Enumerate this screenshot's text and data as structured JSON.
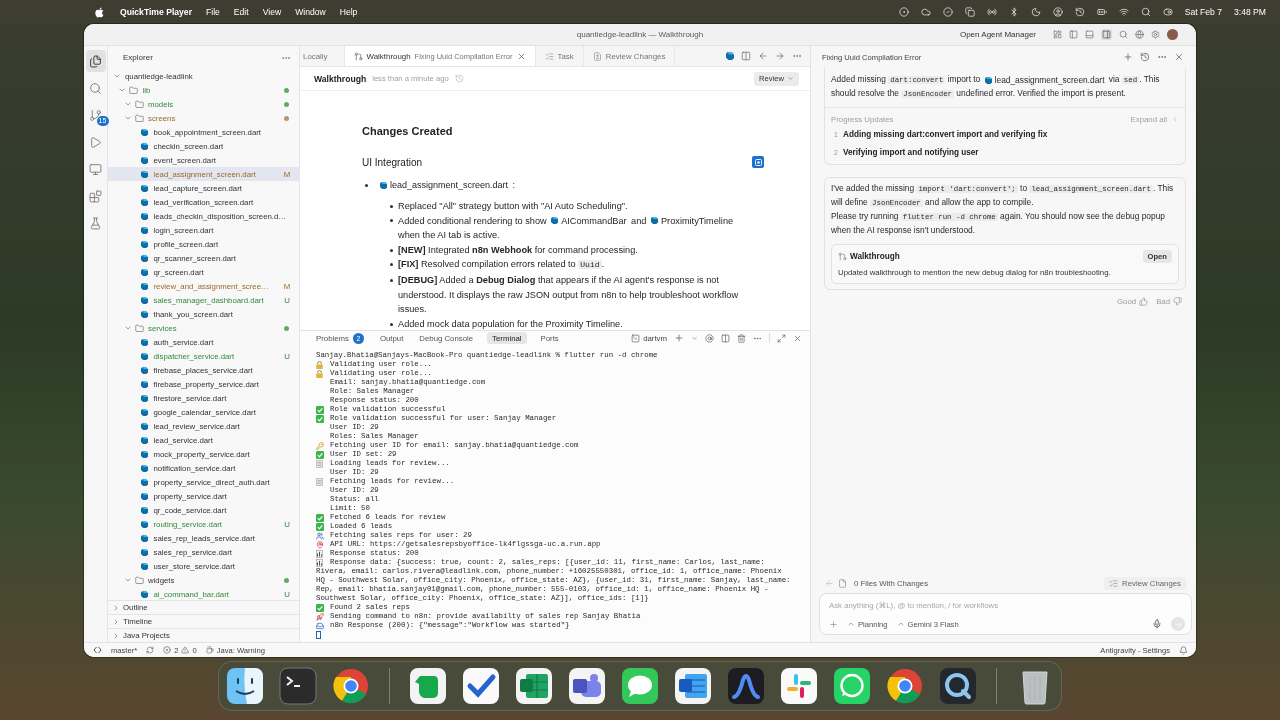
{
  "menu_bar": {
    "app": "QuickTime Player",
    "menus": [
      "File",
      "Edit",
      "View",
      "Window",
      "Help"
    ],
    "date": "Sat Feb 7",
    "time": "3:48 PM"
  },
  "window": {
    "title": "quantiedge-leadlink — Walkthrough",
    "agent_manager": "Open Agent Manager"
  },
  "activity_bar": {
    "items": [
      {
        "kind": "files",
        "selected": true
      },
      {
        "kind": "search",
        "selected": false
      },
      {
        "kind": "source-control",
        "selected": false,
        "badge": "15"
      },
      {
        "kind": "run",
        "selected": false
      },
      {
        "kind": "remote",
        "selected": false
      },
      {
        "kind": "extensions",
        "selected": false
      },
      {
        "kind": "testing",
        "selected": false
      }
    ]
  },
  "explorer": {
    "title": "Explorer",
    "tree": [
      {
        "name": "quantiedge-leadlink",
        "kind": "root",
        "expanded": true,
        "selected": false,
        "modified": false,
        "untracked": false,
        "children": [
          {
            "name": "lib",
            "kind": "folder",
            "expanded": true,
            "selected": false,
            "modified": false,
            "untracked": true,
            "color": "#5fab64",
            "children": [
              {
                "name": "models",
                "kind": "folder",
                "expanded": true,
                "selected": false,
                "modified": false,
                "untracked": true,
                "color": "#5fab64"
              },
              {
                "name": "screens",
                "kind": "folder",
                "expanded": true,
                "selected": false,
                "modified": true,
                "untracked": false,
                "color": "#b59672",
                "children": [
                  {
                    "name": "book_appointment_screen.dart",
                    "kind": "file",
                    "selected": false,
                    "modified": false,
                    "untracked": false
                  },
                  {
                    "name": "checkin_screen.dart",
                    "kind": "file",
                    "selected": false,
                    "modified": false,
                    "untracked": false
                  },
                  {
                    "name": "event_screen.dart",
                    "kind": "file",
                    "selected": false,
                    "modified": false,
                    "untracked": false
                  },
                  {
                    "name": "lead_assignment_screen.dart",
                    "kind": "file",
                    "selected": true,
                    "modified": true,
                    "untracked": false,
                    "badge": "M"
                  },
                  {
                    "name": "lead_capture_screen.dart",
                    "kind": "file",
                    "selected": false,
                    "modified": false,
                    "untracked": false
                  },
                  {
                    "name": "lead_verification_screen.dart",
                    "kind": "file",
                    "selected": false,
                    "modified": false,
                    "untracked": false
                  },
                  {
                    "name": "leads_checkin_disposition_screen.d…",
                    "kind": "file",
                    "selected": false,
                    "modified": false,
                    "untracked": false
                  },
                  {
                    "name": "login_screen.dart",
                    "kind": "file",
                    "selected": false,
                    "modified": false,
                    "untracked": false
                  },
                  {
                    "name": "profile_screen.dart",
                    "kind": "file",
                    "selected": false,
                    "modified": false,
                    "untracked": false
                  },
                  {
                    "name": "qr_scanner_screen.dart",
                    "kind": "file",
                    "selected": false,
                    "modified": false,
                    "untracked": false
                  },
                  {
                    "name": "qr_screen.dart",
                    "kind": "file",
                    "selected": false,
                    "modified": false,
                    "untracked": false
                  },
                  {
                    "name": "review_and_assignment_scree…",
                    "kind": "file",
                    "selected": false,
                    "modified": true,
                    "untracked": false,
                    "badge": "M"
                  },
                  {
                    "name": "sales_manager_dashboard.dart",
                    "kind": "file",
                    "selected": false,
                    "modified": false,
                    "untracked": true,
                    "badge": "U"
                  },
                  {
                    "name": "thank_you_screen.dart",
                    "kind": "file",
                    "selected": false,
                    "modified": false,
                    "untracked": false
                  }
                ]
              },
              {
                "name": "services",
                "kind": "folder",
                "expanded": true,
                "selected": false,
                "modified": false,
                "untracked": true,
                "color": "#5fab64",
                "children": [
                  {
                    "name": "auth_service.dart",
                    "kind": "file",
                    "selected": false,
                    "modified": false,
                    "untracked": false
                  },
                  {
                    "name": "dispatcher_service.dart",
                    "kind": "file",
                    "selected": false,
                    "modified": false,
                    "untracked": true,
                    "badge": "U"
                  },
                  {
                    "name": "firebase_places_service.dart",
                    "kind": "file",
                    "selected": false,
                    "modified": false,
                    "untracked": false
                  },
                  {
                    "name": "firebase_property_service.dart",
                    "kind": "file",
                    "selected": false,
                    "modified": false,
                    "untracked": false
                  },
                  {
                    "name": "firestore_service.dart",
                    "kind": "file",
                    "selected": false,
                    "modified": false,
                    "untracked": false
                  },
                  {
                    "name": "google_calendar_service.dart",
                    "kind": "file",
                    "selected": false,
                    "modified": false,
                    "untracked": false
                  },
                  {
                    "name": "lead_review_service.dart",
                    "kind": "file",
                    "selected": false,
                    "modified": false,
                    "untracked": false
                  },
                  {
                    "name": "lead_service.dart",
                    "kind": "file",
                    "selected": false,
                    "modified": false,
                    "untracked": false
                  },
                  {
                    "name": "mock_property_service.dart",
                    "kind": "file",
                    "selected": false,
                    "modified": false,
                    "untracked": false
                  },
                  {
                    "name": "notification_service.dart",
                    "kind": "file",
                    "selected": false,
                    "modified": false,
                    "untracked": false
                  },
                  {
                    "name": "property_service_direct_auth.dart",
                    "kind": "file",
                    "selected": false,
                    "modified": false,
                    "untracked": false
                  },
                  {
                    "name": "property_service.dart",
                    "kind": "file",
                    "selected": false,
                    "modified": false,
                    "untracked": false
                  },
                  {
                    "name": "qr_code_service.dart",
                    "kind": "file",
                    "selected": false,
                    "modified": false,
                    "untracked": false
                  },
                  {
                    "name": "routing_service.dart",
                    "kind": "file",
                    "selected": false,
                    "modified": false,
                    "untracked": true,
                    "badge": "U"
                  },
                  {
                    "name": "sales_rep_leads_service.dart",
                    "kind": "file",
                    "selected": false,
                    "modified": false,
                    "untracked": false
                  },
                  {
                    "name": "sales_rep_service.dart",
                    "kind": "file",
                    "selected": false,
                    "modified": false,
                    "untracked": false
                  },
                  {
                    "name": "user_store_service.dart",
                    "kind": "file",
                    "selected": false,
                    "modified": false,
                    "untracked": false
                  }
                ]
              },
              {
                "name": "widgets",
                "kind": "folder",
                "expanded": true,
                "selected": false,
                "modified": false,
                "untracked": false,
                "color": "#5fab64",
                "children": [
                  {
                    "name": "ai_command_bar.dart",
                    "kind": "file",
                    "selected": false,
                    "modified": false,
                    "untracked": true,
                    "badge": "U"
                  }
                ]
              }
            ]
          }
        ]
      }
    ],
    "sections": [
      {
        "label": "Outline",
        "expanded": false
      },
      {
        "label": "Timeline",
        "expanded": false
      },
      {
        "label": "Java Projects",
        "expanded": false
      }
    ]
  },
  "editor": {
    "tabs": [
      {
        "label": "Locally",
        "kind": "plain",
        "selected": false
      },
      {
        "label": "Walkthrough",
        "description": "Fixing Uuid Compilation Error",
        "kind": "walkthrough",
        "selected": true
      },
      {
        "label": "Task",
        "kind": "task",
        "selected": false
      },
      {
        "label": "Review Changes",
        "kind": "review",
        "selected": false
      }
    ],
    "header": {
      "title": "Walkthrough",
      "time": "less than a minute ago",
      "button": "Review"
    },
    "document": {
      "heading": "Changes Created",
      "subheading": "UI Integration",
      "items": [
        {
          "segments": [
            {
              "kind": "file",
              "text": "lead_assignment_screen.dart"
            },
            {
              "kind": "text",
              "text": " :"
            }
          ],
          "children": [
            [
              {
                "kind": "text",
                "text": "Replaced \"All\" strategy button with \"AI Auto Scheduling\"."
              }
            ],
            [
              {
                "kind": "text",
                "text": "Added conditional rendering to show "
              },
              {
                "kind": "file",
                "text": "AICommandBar"
              },
              {
                "kind": "text",
                "text": " and "
              },
              {
                "kind": "file",
                "text": "ProximityTimeline"
              },
              {
                "kind": "text",
                "text": " when the AI tab is active."
              }
            ],
            [
              {
                "kind": "text",
                "text": "**[NEW]** Integrated **n8n Webhook** for command processing."
              }
            ],
            [
              {
                "kind": "text",
                "text": "**[FIX]** Resolved compilation errors related to "
              },
              {
                "kind": "code",
                "text": "Uuid"
              },
              {
                "kind": "text",
                "text": "."
              }
            ],
            [
              {
                "kind": "text",
                "text": "**[DEBUG]** Added a **Debug Dialog** that appears if the AI agent's response is not understood. It displays the raw JSON output from n8n to help troubleshoot workflow issues."
              }
            ],
            [
              {
                "kind": "text",
                "text": "Added mock data population for the Proximity Timeline."
              }
            ]
          ]
        }
      ]
    }
  },
  "panel": {
    "tabs": [
      {
        "label": "Problems",
        "badge": "2",
        "selected": false
      },
      {
        "label": "Output",
        "selected": false
      },
      {
        "label": "Debug Console",
        "selected": false
      },
      {
        "label": "Terminal",
        "selected": true
      },
      {
        "label": "Ports",
        "selected": false
      }
    ],
    "shell": "dartvm",
    "lines": [
      {
        "kind": "prompt",
        "text": "Sanjay.Bhatia@Sanjays-MacBook-Pro quantiedge-leadlink % flutter run -d chrome"
      },
      {
        "kind": "lock",
        "text": "Validating user role..."
      },
      {
        "kind": "lock",
        "text": "Validating user role..."
      },
      {
        "kind": "plain",
        "text": "Email: sanjay.bhatia@quantiedge.com"
      },
      {
        "kind": "plain",
        "text": "Role: Sales Manager"
      },
      {
        "kind": "plain",
        "text": "Response status: 200"
      },
      {
        "kind": "check",
        "text": "Role validation successful"
      },
      {
        "kind": "check",
        "text": "Role validation successful for user: Sanjay Manager"
      },
      {
        "kind": "plain",
        "text": "User ID: 29"
      },
      {
        "kind": "plain",
        "text": "Roles: Sales Manager"
      },
      {
        "kind": "key",
        "text": "Fetching user ID for email: sanjay.bhatia@quantiedge.com"
      },
      {
        "kind": "check",
        "text": "User ID set: 29"
      },
      {
        "kind": "memo",
        "text": "Loading leads for review..."
      },
      {
        "kind": "plain",
        "text": "User ID: 29"
      },
      {
        "kind": "memo",
        "text": "Fetching leads for review..."
      },
      {
        "kind": "plain",
        "text": "User ID: 29"
      },
      {
        "kind": "plain",
        "text": "Status: all"
      },
      {
        "kind": "plain",
        "text": "Limit: 50"
      },
      {
        "kind": "check",
        "text": "Fetched 6 leads for review"
      },
      {
        "kind": "check",
        "text": "Loaded 6 leads"
      },
      {
        "kind": "people",
        "text": "Fetching sales reps for user: 29"
      },
      {
        "kind": "pin",
        "text": "API URL: https://getsalesrepsbyoffice-lk4flgssga-uc.a.run.app"
      },
      {
        "kind": "chart",
        "text": "Response status: 200"
      },
      {
        "kind": "chart",
        "text": "Response data: {success: true, count: 2, sales_reps: [{user_id: 11, first_name: Carlos, last_name:"
      },
      {
        "kind": "wrap",
        "text": "Rivera, email: carlos.rivera@leadlink.com, phone_number: +16025550301, office_id: 1, office_name: Phoenix"
      },
      {
        "kind": "wrap",
        "text": "HQ - Southwest Solar, office_city: Phoenix, office_state: AZ}, {user_id: 31, first_name: Sanjay, last_name:"
      },
      {
        "kind": "wrap",
        "text": "Rep, email: bhatia.sanjay01@gmail.com, phone_number: 555-0103, office_id: 1, office_name: Phoenix HQ -"
      },
      {
        "kind": "wrap",
        "text": "Southwest Solar, office_city: Phoenix, office_state: AZ}], office_ids: [1]}"
      },
      {
        "kind": "check",
        "text": "Found 2 sales reps"
      },
      {
        "kind": "rocket",
        "text": "Sending command to n8n: provide availabilty of sales rep Sanjay Bhatia"
      },
      {
        "kind": "inbox",
        "text": "n8n Response (200): {\"message\":\"Workflow was started\"}"
      },
      {
        "kind": "cursor"
      }
    ]
  },
  "agent": {
    "title": "Fixing Uuid Compilation Error",
    "summary": [
      {
        "kind": "text",
        "text": "Added missing "
      },
      {
        "kind": "code",
        "text": "dart:convert"
      },
      {
        "kind": "text",
        "text": " import to "
      },
      {
        "kind": "file",
        "text": "lead_assignment_screen.dart"
      },
      {
        "kind": "text",
        "text": " via "
      },
      {
        "kind": "code",
        "text": "sed"
      },
      {
        "kind": "text",
        "text": ". This should resolve the "
      },
      {
        "kind": "code",
        "text": "JsonEncoder"
      },
      {
        "kind": "text",
        "text": " undefined error. Verified the import is present."
      }
    ],
    "progress": {
      "title": "Progress Updates",
      "toggle": "Expand all",
      "steps": [
        {
          "number": "1",
          "text": "Adding missing dart:convert import and verifying fix"
        },
        {
          "number": "2",
          "text": "Verifying import and notifying user"
        }
      ]
    },
    "reply": {
      "paragraphs": [
        [
          {
            "kind": "text",
            "text": "I've added the missing "
          },
          {
            "kind": "code",
            "text": "import 'dart:convert';"
          },
          {
            "kind": "text",
            "text": " to "
          },
          {
            "kind": "code",
            "text": "lead_assignment_screen.dart"
          },
          {
            "kind": "text",
            "text": ". This will define "
          },
          {
            "kind": "code",
            "text": "JsonEncoder"
          },
          {
            "kind": "text",
            "text": " and allow the app to compile."
          }
        ],
        [
          {
            "kind": "text",
            "text": "Please try running "
          },
          {
            "kind": "code",
            "text": "flutter run -d chrome"
          },
          {
            "kind": "text",
            "text": " again. You should now see the debug popup when the AI response isn't understood."
          }
        ]
      ],
      "artifact": {
        "title": "Walkthrough",
        "button": "Open",
        "description": "Updated walkthrough to mention the new debug dialog for n8n troubleshooting."
      }
    },
    "feedback": [
      {
        "label": "Good",
        "kind": "up"
      },
      {
        "label": "Bad",
        "kind": "down"
      }
    ],
    "changes": {
      "label": "0 Files With Changes",
      "button": "Review Changes"
    },
    "input": {
      "placeholder": "Ask anything (⌘L), @ to mention, / for workflows",
      "mode": "Planning",
      "model": "Gemini 3 Flash"
    }
  },
  "status_bar": {
    "branch": "master*",
    "errors": "2",
    "warnings": "0",
    "language": "Java: Warning",
    "settings": "Antigravity - Settings"
  },
  "dock": [
    {
      "kind": "finder"
    },
    {
      "kind": "terminal"
    },
    {
      "kind": "browser"
    },
    {
      "kind": "separator"
    },
    {
      "kind": "notes"
    },
    {
      "kind": "todo"
    },
    {
      "kind": "spreadsheet"
    },
    {
      "kind": "teams"
    },
    {
      "kind": "messages"
    },
    {
      "kind": "document"
    },
    {
      "kind": "arch"
    },
    {
      "kind": "hash"
    },
    {
      "kind": "phone-chat"
    },
    {
      "kind": "browser"
    },
    {
      "kind": "player"
    },
    {
      "kind": "separator"
    },
    {
      "kind": "trash"
    }
  ]
}
